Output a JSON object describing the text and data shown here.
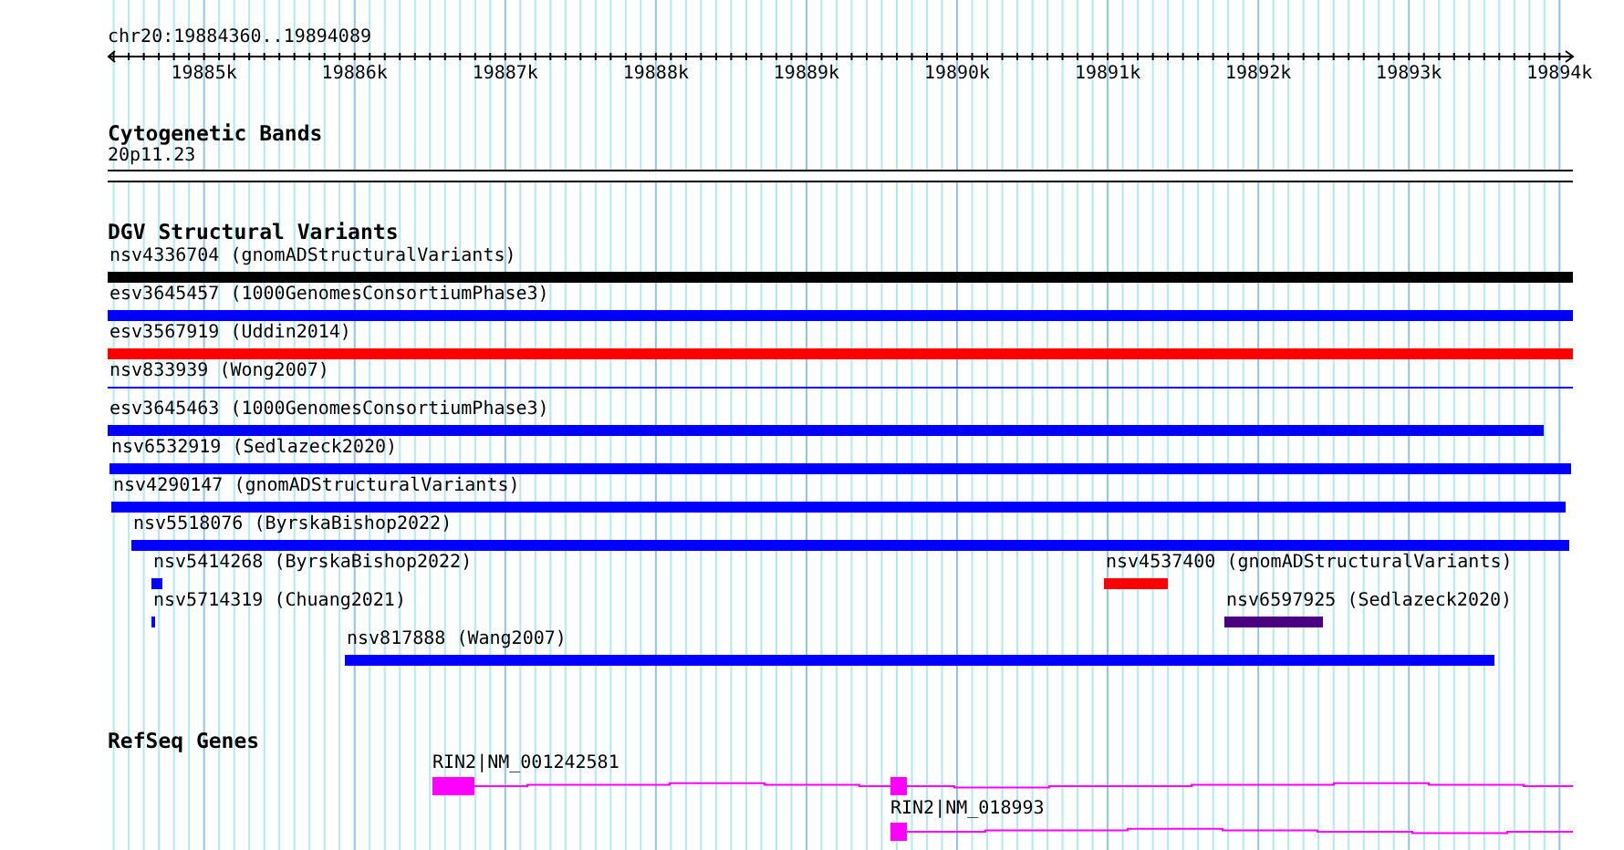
{
  "ruler": {
    "location": "chr20:19884360..19894089",
    "labels": [
      "19885k",
      "19886k",
      "19887k",
      "19888k",
      "19889k",
      "19890k",
      "19891k",
      "19892k",
      "19893k",
      "19894k"
    ]
  },
  "tracks": [
    {
      "kind": "cytoband",
      "title": "Cytogenetic Bands",
      "bands": [
        {
          "name": "20p11.23"
        }
      ]
    },
    {
      "kind": "variants",
      "title": "DGV Structural Variants",
      "rows": [
        [
          {
            "label": "nsv4336704 (gnomADStructuralVariants)",
            "color": "#000000",
            "kind": "bar"
          }
        ],
        [
          {
            "label": "esv3645457 (1000GenomesConsortiumPhase3)",
            "color": "#0000ff",
            "kind": "bar"
          }
        ],
        [
          {
            "label": "esv3567919 (Uddin2014)",
            "color": "#ff0000",
            "kind": "bar"
          }
        ],
        [
          {
            "label": "nsv833939 (Wong2007)",
            "color": "#0000ff",
            "kind": "line"
          }
        ],
        [
          {
            "label": "esv3645463 (1000GenomesConsortiumPhase3)",
            "color": "#0000ff",
            "kind": "bar"
          }
        ],
        [
          {
            "label": "nsv6532919 (Sedlazeck2020)",
            "color": "#0000ff",
            "kind": "bar"
          }
        ],
        [
          {
            "label": "nsv4290147 (gnomADStructuralVariants)",
            "color": "#0000ff",
            "kind": "bar"
          }
        ],
        [
          {
            "label": "nsv5518076 (ByrskaBishop2022)",
            "color": "#0000ff",
            "kind": "bar"
          }
        ],
        [
          {
            "label": "nsv5414268 (ByrskaBishop2022)",
            "color": "#0000ff",
            "kind": "bar"
          },
          {
            "label": "nsv4537400 (gnomADStructuralVariants)",
            "color": "#ff0000",
            "kind": "bar"
          }
        ],
        [
          {
            "label": "nsv5714319 (Chuang2021)",
            "color": "#0000ff",
            "kind": "bar"
          },
          {
            "label": "nsv6597925 (Sedlazeck2020)",
            "color": "#4b0082",
            "kind": "bar"
          }
        ],
        [
          {
            "label": "nsv817888 (Wang2007)",
            "color": "#0000ff",
            "kind": "bar"
          }
        ]
      ]
    },
    {
      "kind": "genes",
      "title": "RefSeq Genes",
      "genes": [
        {
          "label": "RIN2|NM_001242581"
        },
        {
          "label": "RIN2|NM_018993"
        }
      ]
    }
  ]
}
